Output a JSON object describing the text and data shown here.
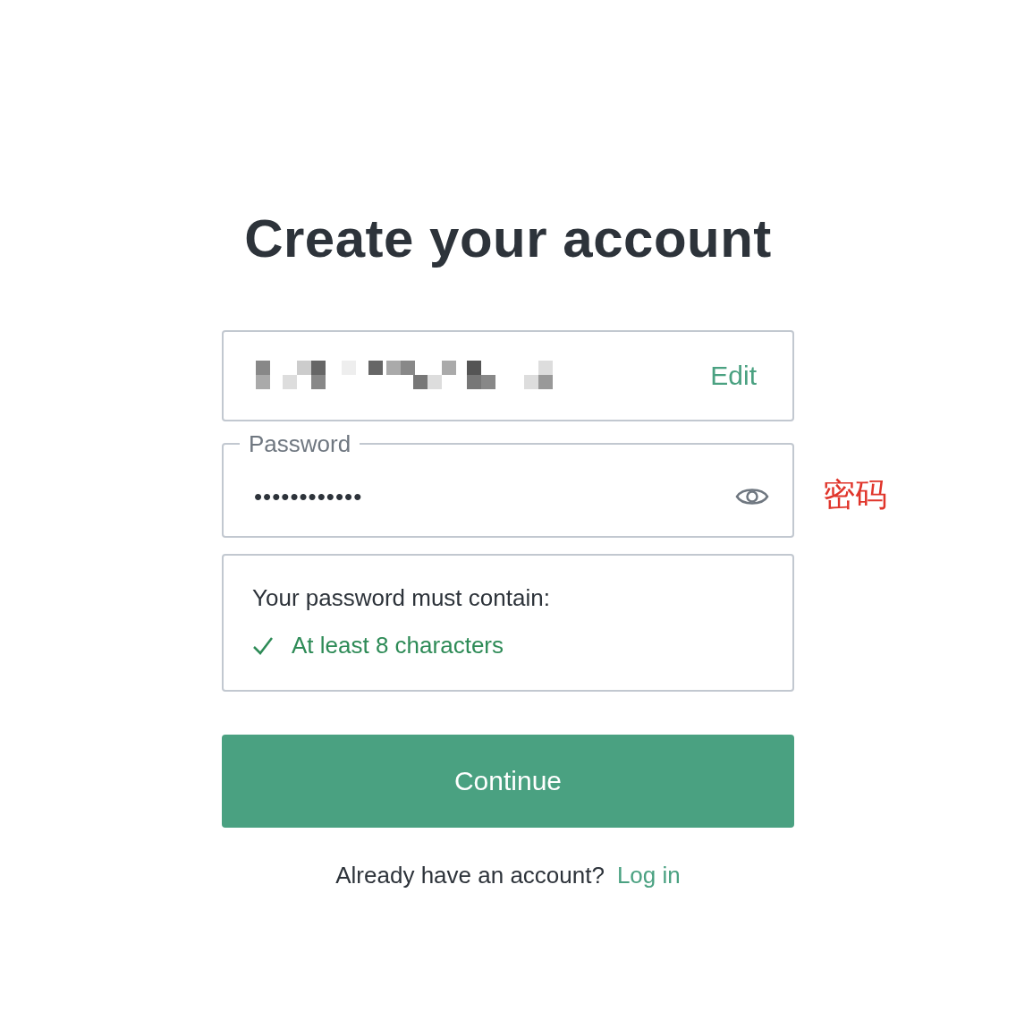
{
  "title": "Create your account",
  "email_field": {
    "action": "Edit"
  },
  "password_field": {
    "label": "Password",
    "value": "••••••••••••",
    "annotation": "密码"
  },
  "requirements": {
    "heading": "Your password must contain:",
    "items": [
      {
        "text": "At least 8 characters",
        "met": true
      }
    ]
  },
  "continue_button": "Continue",
  "footer": {
    "prompt": "Already have an account?",
    "link": "Log in"
  }
}
